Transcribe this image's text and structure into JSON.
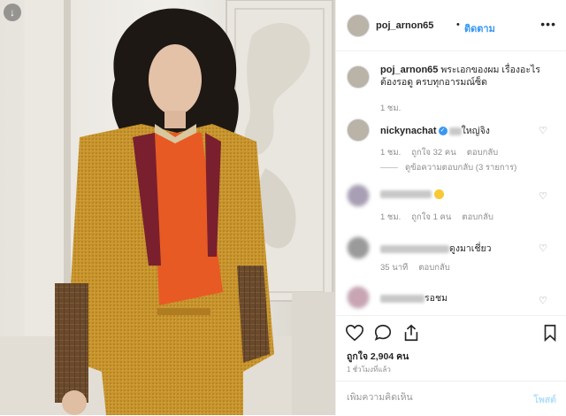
{
  "photo": {
    "download_icon": "download-arrow-icon"
  },
  "header": {
    "username": "poj_arnon65",
    "separator": "•",
    "follow_label": "ติดตาม",
    "more_icon": "ellipsis-icon"
  },
  "caption": {
    "username": "poj_arnon65",
    "text": "พระเอกของผม เรื่องอะไร ต้องรอดู ครบทุกอารมณ์ซ็ด",
    "time": "1 ชม."
  },
  "comments": [
    {
      "username": "nickynachat",
      "text": "ใหญ่จิง",
      "time": "1 ชม.",
      "likes": "ถูกใจ 32 คน",
      "reply_label": "ตอบกลับ",
      "view_replies": "ดูข้อความตอบกลับ (3 รายการ)"
    },
    {
      "username": "",
      "text": "",
      "time": "1 ชม.",
      "likes": "ถูกใจ 1 คน",
      "reply_label": "ตอบกลับ"
    },
    {
      "username": "",
      "text": "ดูงมาเชี่ยว",
      "time": "35 นาที",
      "reply_label": "ตอบกลับ"
    },
    {
      "username": "",
      "text": "รอชม"
    }
  ],
  "actions": {
    "like_icon": "heart-icon",
    "comment_icon": "comment-icon",
    "share_icon": "share-icon",
    "save_icon": "bookmark-icon",
    "likes_text": "ถูกใจ 2,904 คน",
    "posted_time": "1 ชั่วโมงที่แล้ว"
  },
  "add_comment": {
    "placeholder": "เพิ่มความคิดเห็น",
    "post_label": "โพสต์"
  },
  "colors": {
    "link_blue": "#3897f0",
    "post_disabled": "#b2dffc",
    "muted": "#8e8e8e"
  }
}
